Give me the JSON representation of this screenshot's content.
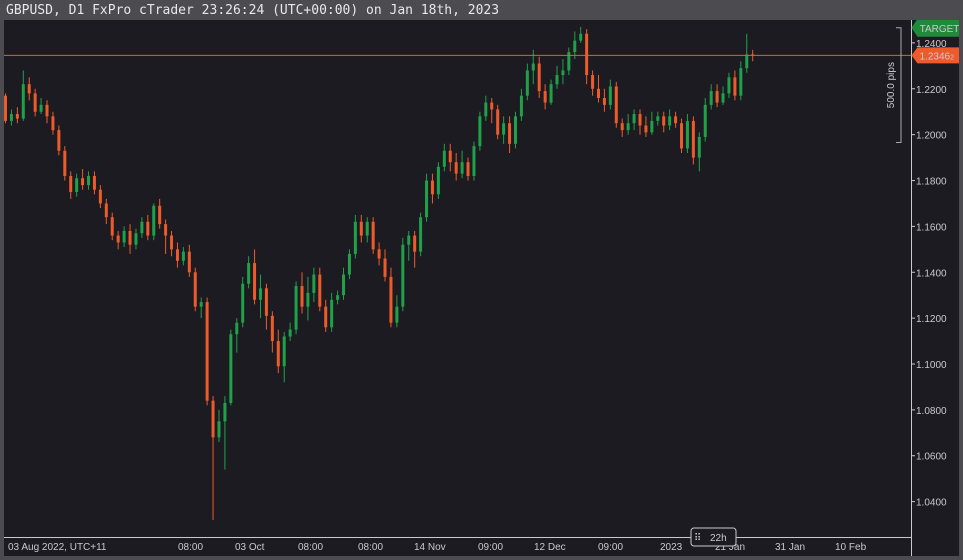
{
  "window": {
    "title": "GBPUSD, D1 FxPro cTrader 23:26:24 (UTC+00:00) on Jan 18th, 2023"
  },
  "colors": {
    "background": "#1c1b22",
    "bull": "#1fa14a",
    "bear": "#ee5b2b",
    "price_line": "#ee5b2b",
    "target": "#1e8a3a"
  },
  "chart_data": {
    "type": "candlestick",
    "symbol": "GBPUSD",
    "timeframe": "D1",
    "ylim": [
      1.025,
      1.25
    ],
    "y_ticks": [
      {
        "value": 1.24,
        "label": "1.2400"
      },
      {
        "value": 1.22,
        "label": "1.2200"
      },
      {
        "value": 1.2,
        "label": "1.2000"
      },
      {
        "value": 1.18,
        "label": "1.1800"
      },
      {
        "value": 1.16,
        "label": "1.1600"
      },
      {
        "value": 1.14,
        "label": "1.1400"
      },
      {
        "value": 1.12,
        "label": "1.1200"
      },
      {
        "value": 1.1,
        "label": "1.1000"
      },
      {
        "value": 1.08,
        "label": "1.0800"
      },
      {
        "value": 1.06,
        "label": "1.0600"
      },
      {
        "value": 1.04,
        "label": "1.0400"
      }
    ],
    "x_labels": [
      "03 Aug 2022, UTC+11",
      "08:00",
      "03 Oct",
      "08:00",
      "08:00",
      "14 Nov",
      "09:00",
      "12 Dec",
      "09:00",
      "2023",
      "21 Jan",
      "31 Jan",
      "10 Feb"
    ],
    "current_price": {
      "value": 1.2346,
      "label": "1.2346",
      "suffix": "2"
    },
    "target": {
      "label": "TARGET",
      "value": 1.2466
    },
    "measure": {
      "label": "500.0 pips",
      "from": 1.1966,
      "to": 1.2466
    },
    "time_badge": "22h",
    "candles": [
      [
        1.217,
        1.206,
        1.218,
        1.205
      ],
      [
        1.206,
        1.209,
        1.211,
        1.204
      ],
      [
        1.209,
        1.207,
        1.212,
        1.205
      ],
      [
        1.207,
        1.222,
        1.228,
        1.206
      ],
      [
        1.222,
        1.218,
        1.225,
        1.215
      ],
      [
        1.218,
        1.21,
        1.22,
        1.208
      ],
      [
        1.21,
        1.213,
        1.216,
        1.209
      ],
      [
        1.213,
        1.208,
        1.215,
        1.205
      ],
      [
        1.208,
        1.202,
        1.21,
        1.2
      ],
      [
        1.202,
        1.193,
        1.204,
        1.191
      ],
      [
        1.193,
        1.182,
        1.195,
        1.18
      ],
      [
        1.182,
        1.175,
        1.184,
        1.172
      ],
      [
        1.175,
        1.181,
        1.183,
        1.173
      ],
      [
        1.181,
        1.178,
        1.185,
        1.176
      ],
      [
        1.178,
        1.182,
        1.184,
        1.176
      ],
      [
        1.182,
        1.176,
        1.184,
        1.174
      ],
      [
        1.176,
        1.17,
        1.178,
        1.168
      ],
      [
        1.17,
        1.164,
        1.172,
        1.161
      ],
      [
        1.164,
        1.156,
        1.166,
        1.154
      ],
      [
        1.156,
        1.153,
        1.158,
        1.15
      ],
      [
        1.153,
        1.158,
        1.16,
        1.151
      ],
      [
        1.158,
        1.152,
        1.161,
        1.148
      ],
      [
        1.152,
        1.157,
        1.159,
        1.15
      ],
      [
        1.157,
        1.162,
        1.164,
        1.155
      ],
      [
        1.162,
        1.156,
        1.165,
        1.154
      ],
      [
        1.156,
        1.169,
        1.17,
        1.154
      ],
      [
        1.169,
        1.161,
        1.172,
        1.159
      ],
      [
        1.161,
        1.156,
        1.163,
        1.148
      ],
      [
        1.156,
        1.15,
        1.158,
        1.147
      ],
      [
        1.15,
        1.145,
        1.153,
        1.142
      ],
      [
        1.145,
        1.149,
        1.151,
        1.143
      ],
      [
        1.149,
        1.14,
        1.152,
        1.138
      ],
      [
        1.14,
        1.125,
        1.142,
        1.123
      ],
      [
        1.125,
        1.127,
        1.129,
        1.12
      ],
      [
        1.127,
        1.084,
        1.129,
        1.082
      ],
      [
        1.084,
        1.068,
        1.086,
        1.032
      ],
      [
        1.068,
        1.075,
        1.08,
        1.066
      ],
      [
        1.075,
        1.083,
        1.086,
        1.054
      ],
      [
        1.083,
        1.113,
        1.115,
        1.082
      ],
      [
        1.113,
        1.118,
        1.12,
        1.105
      ],
      [
        1.118,
        1.135,
        1.138,
        1.116
      ],
      [
        1.135,
        1.144,
        1.147,
        1.133
      ],
      [
        1.144,
        1.128,
        1.15,
        1.126
      ],
      [
        1.128,
        1.133,
        1.139,
        1.12
      ],
      [
        1.133,
        1.121,
        1.135,
        1.115
      ],
      [
        1.121,
        1.11,
        1.123,
        1.105
      ],
      [
        1.11,
        1.099,
        1.115,
        1.096
      ],
      [
        1.099,
        1.112,
        1.114,
        1.092
      ],
      [
        1.112,
        1.115,
        1.118,
        1.11
      ],
      [
        1.115,
        1.134,
        1.136,
        1.113
      ],
      [
        1.134,
        1.125,
        1.14,
        1.122
      ],
      [
        1.125,
        1.131,
        1.138,
        1.119
      ],
      [
        1.131,
        1.139,
        1.142,
        1.127
      ],
      [
        1.139,
        1.125,
        1.142,
        1.123
      ],
      [
        1.125,
        1.116,
        1.128,
        1.114
      ],
      [
        1.116,
        1.128,
        1.131,
        1.114
      ],
      [
        1.128,
        1.13,
        1.132,
        1.126
      ],
      [
        1.13,
        1.139,
        1.142,
        1.128
      ],
      [
        1.139,
        1.148,
        1.15,
        1.137
      ],
      [
        1.148,
        1.162,
        1.165,
        1.146
      ],
      [
        1.162,
        1.156,
        1.165,
        1.153
      ],
      [
        1.156,
        1.162,
        1.164,
        1.153
      ],
      [
        1.162,
        1.15,
        1.164,
        1.148
      ],
      [
        1.15,
        1.146,
        1.153,
        1.143
      ],
      [
        1.146,
        1.138,
        1.15,
        1.136
      ],
      [
        1.138,
        1.118,
        1.142,
        1.116
      ],
      [
        1.118,
        1.125,
        1.13,
        1.116
      ],
      [
        1.125,
        1.152,
        1.155,
        1.123
      ],
      [
        1.152,
        1.156,
        1.158,
        1.145
      ],
      [
        1.156,
        1.149,
        1.158,
        1.142
      ],
      [
        1.149,
        1.164,
        1.166,
        1.147
      ],
      [
        1.164,
        1.18,
        1.183,
        1.162
      ],
      [
        1.18,
        1.174,
        1.183,
        1.17
      ],
      [
        1.174,
        1.186,
        1.188,
        1.172
      ],
      [
        1.186,
        1.193,
        1.196,
        1.184
      ],
      [
        1.193,
        1.188,
        1.196,
        1.184
      ],
      [
        1.188,
        1.183,
        1.192,
        1.18
      ],
      [
        1.183,
        1.188,
        1.193,
        1.181
      ],
      [
        1.188,
        1.182,
        1.19,
        1.18
      ],
      [
        1.182,
        1.195,
        1.197,
        1.18
      ],
      [
        1.195,
        1.208,
        1.21,
        1.193
      ],
      [
        1.208,
        1.214,
        1.217,
        1.206
      ],
      [
        1.214,
        1.211,
        1.216,
        1.205
      ],
      [
        1.211,
        1.2,
        1.213,
        1.198
      ],
      [
        1.2,
        1.205,
        1.208,
        1.196
      ],
      [
        1.205,
        1.196,
        1.208,
        1.192
      ],
      [
        1.196,
        1.208,
        1.21,
        1.194
      ],
      [
        1.208,
        1.217,
        1.22,
        1.206
      ],
      [
        1.217,
        1.228,
        1.231,
        1.215
      ],
      [
        1.228,
        1.231,
        1.237,
        1.222
      ],
      [
        1.231,
        1.219,
        1.234,
        1.216
      ],
      [
        1.219,
        1.214,
        1.222,
        1.211
      ],
      [
        1.214,
        1.222,
        1.224,
        1.213
      ],
      [
        1.222,
        1.226,
        1.23,
        1.22
      ],
      [
        1.226,
        1.228,
        1.233,
        1.222
      ],
      [
        1.228,
        1.236,
        1.238,
        1.226
      ],
      [
        1.236,
        1.241,
        1.245,
        1.233
      ],
      [
        1.241,
        1.244,
        1.247,
        1.24
      ],
      [
        1.244,
        1.226,
        1.246,
        1.222
      ],
      [
        1.226,
        1.22,
        1.228,
        1.217
      ],
      [
        1.22,
        1.216,
        1.226,
        1.214
      ],
      [
        1.216,
        1.213,
        1.22,
        1.21
      ],
      [
        1.213,
        1.221,
        1.224,
        1.211
      ],
      [
        1.221,
        1.205,
        1.223,
        1.203
      ],
      [
        1.205,
        1.202,
        1.207,
        1.199
      ],
      [
        1.202,
        1.205,
        1.209,
        1.2
      ],
      [
        1.205,
        1.209,
        1.211,
        1.202
      ],
      [
        1.209,
        1.204,
        1.211,
        1.2
      ],
      [
        1.204,
        1.201,
        1.208,
        1.199
      ],
      [
        1.201,
        1.206,
        1.21,
        1.2
      ],
      [
        1.206,
        1.208,
        1.21,
        1.204
      ],
      [
        1.208,
        1.204,
        1.21,
        1.201
      ],
      [
        1.204,
        1.208,
        1.211,
        1.202
      ],
      [
        1.208,
        1.205,
        1.21,
        1.203
      ],
      [
        1.205,
        1.194,
        1.207,
        1.192
      ],
      [
        1.194,
        1.206,
        1.209,
        1.192
      ],
      [
        1.206,
        1.19,
        1.208,
        1.187
      ],
      [
        1.19,
        1.199,
        1.201,
        1.184
      ],
      [
        1.199,
        1.213,
        1.216,
        1.197
      ],
      [
        1.213,
        1.219,
        1.222,
        1.211
      ],
      [
        1.219,
        1.214,
        1.222,
        1.212
      ],
      [
        1.214,
        1.218,
        1.221,
        1.213
      ],
      [
        1.218,
        1.225,
        1.227,
        1.216
      ],
      [
        1.225,
        1.217,
        1.228,
        1.215
      ],
      [
        1.217,
        1.229,
        1.232,
        1.215
      ],
      [
        1.229,
        1.235,
        1.244,
        1.227
      ],
      [
        1.235,
        1.2346,
        1.237,
        1.232
      ]
    ]
  }
}
